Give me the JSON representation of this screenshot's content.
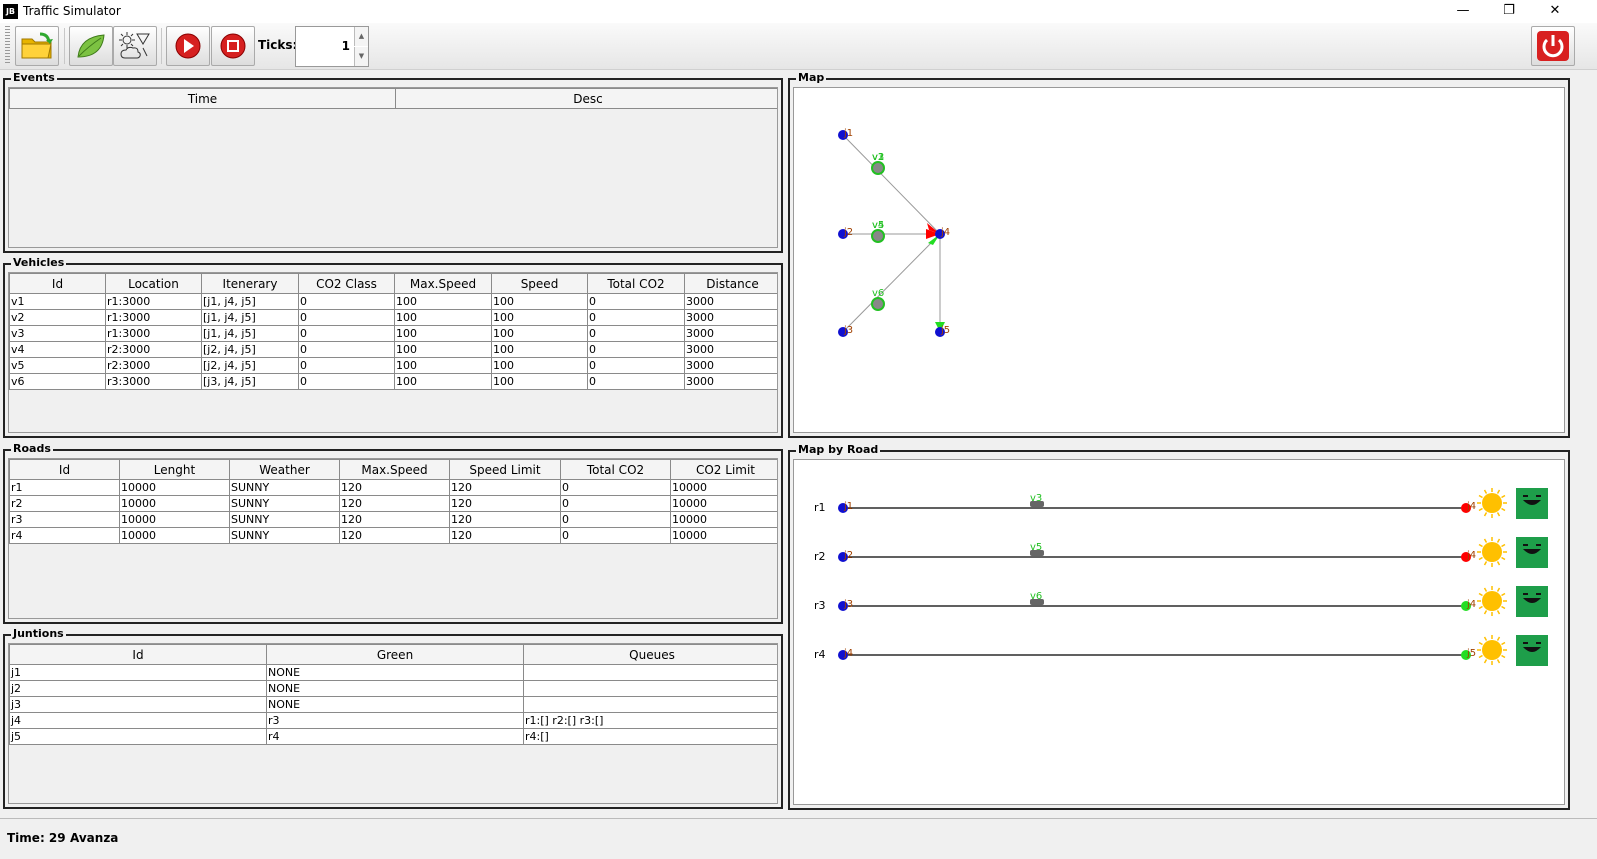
{
  "window": {
    "app_icon": "JB",
    "title": "Traffic Simulator",
    "minimize": "—",
    "restore": "❐",
    "close": "✕"
  },
  "toolbar": {
    "buttons": [
      {
        "name": "open-folder-icon"
      },
      {
        "name": "co2-leaf-icon"
      },
      {
        "name": "weather-icon"
      },
      {
        "name": "run-icon"
      },
      {
        "name": "stop-icon"
      }
    ],
    "ticks_label": "Ticks:",
    "ticks_value": "1",
    "exit": "power-icon"
  },
  "events": {
    "title": "Events",
    "columns": [
      "Time",
      "Desc"
    ],
    "rows": []
  },
  "vehicles": {
    "title": "Vehicles",
    "columns": [
      "Id",
      "Location",
      "Itenerary",
      "CO2 Class",
      "Max.Speed",
      "Speed",
      "Total CO2",
      "Distance"
    ],
    "rows": [
      [
        "v1",
        "r1:3000",
        "[j1, j4, j5]",
        "0",
        "100",
        "100",
        "0",
        "3000"
      ],
      [
        "v2",
        "r1:3000",
        "[j1, j4, j5]",
        "0",
        "100",
        "100",
        "0",
        "3000"
      ],
      [
        "v3",
        "r1:3000",
        "[j1, j4, j5]",
        "0",
        "100",
        "100",
        "0",
        "3000"
      ],
      [
        "v4",
        "r2:3000",
        "[j2, j4, j5]",
        "0",
        "100",
        "100",
        "0",
        "3000"
      ],
      [
        "v5",
        "r2:3000",
        "[j2, j4, j5]",
        "0",
        "100",
        "100",
        "0",
        "3000"
      ],
      [
        "v6",
        "r3:3000",
        "[j3, j4, j5]",
        "0",
        "100",
        "100",
        "0",
        "3000"
      ]
    ]
  },
  "roads": {
    "title": "Roads",
    "columns": [
      "Id",
      "Lenght",
      "Weather",
      "Max.Speed",
      "Speed Limit",
      "Total CO2",
      "CO2 Limit"
    ],
    "rows": [
      [
        "r1",
        "10000",
        "SUNNY",
        "120",
        "120",
        "0",
        "10000"
      ],
      [
        "r2",
        "10000",
        "SUNNY",
        "120",
        "120",
        "0",
        "10000"
      ],
      [
        "r3",
        "10000",
        "SUNNY",
        "120",
        "120",
        "0",
        "10000"
      ],
      [
        "r4",
        "10000",
        "SUNNY",
        "120",
        "120",
        "0",
        "10000"
      ]
    ]
  },
  "junctions": {
    "title": "Juntions",
    "columns": [
      "Id",
      "Green",
      "Queues"
    ],
    "rows": [
      [
        "j1",
        "NONE",
        ""
      ],
      [
        "j2",
        "NONE",
        ""
      ],
      [
        "j3",
        "NONE",
        ""
      ],
      [
        "j4",
        "r3",
        "r1:[] r2:[] r3:[]"
      ],
      [
        "j5",
        "r4",
        "r4:[]"
      ]
    ]
  },
  "map": {
    "title": "Map",
    "junctions": [
      "j1",
      "j2",
      "j3",
      "j4",
      "j5"
    ],
    "vehicles": [
      "v1",
      "v2",
      "v3",
      "v4",
      "v5",
      "v6"
    ]
  },
  "map_by_road": {
    "title": "Map by Road",
    "roads": [
      {
        "id": "r1",
        "src": "j1",
        "dest": "j4",
        "vehicle_labels": "v3",
        "light": "red",
        "weather": "sun-icon",
        "co2": "smiley-icon"
      },
      {
        "id": "r2",
        "src": "j2",
        "dest": "j4",
        "vehicle_labels": "v5",
        "light": "red",
        "weather": "sun-icon",
        "co2": "smiley-icon"
      },
      {
        "id": "r3",
        "src": "j3",
        "dest": "j4",
        "vehicle_labels": "v6",
        "light": "green",
        "weather": "sun-icon",
        "co2": "smiley-icon"
      },
      {
        "id": "r4",
        "src": "j4",
        "dest": "j5",
        "vehicle_labels": "",
        "light": "green",
        "weather": "sun-icon",
        "co2": "smiley-icon"
      }
    ]
  },
  "status": {
    "time_label": "Time: 29",
    "message": "Avanza"
  },
  "colors": {
    "junction": "#1010d0",
    "label": "#a04000",
    "vehicle_label": "#22c022",
    "red_light": "#ff0000",
    "green_light": "#22dd22",
    "sun": "#ffc000",
    "co2_box": "#1e9e4a"
  }
}
